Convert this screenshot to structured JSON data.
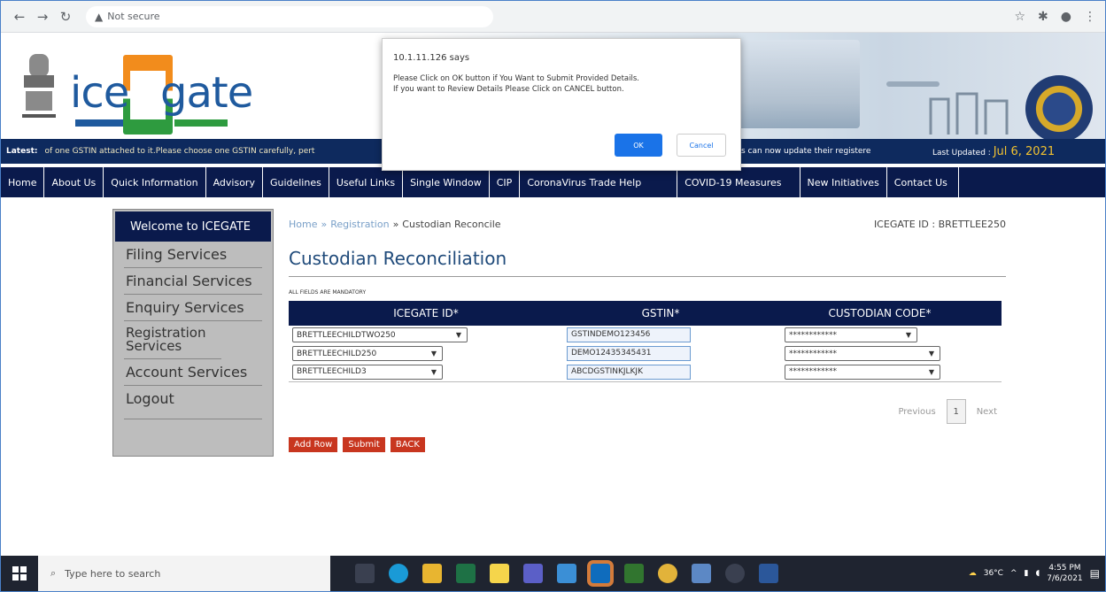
{
  "browser": {
    "security_label": "Not secure",
    "url": ""
  },
  "header": {
    "logo_left": "ice",
    "logo_right": "gate"
  },
  "ticker": {
    "label": "Latest:",
    "message": "of one GSTIN attached to it.Please choose one GSTIN carefully, pert",
    "message2": "s can now update their registere",
    "updated_label": "Last Updated :",
    "updated_date": "Jul 6, 2021"
  },
  "nav": [
    "Home",
    "About Us",
    "Quick Information",
    "Advisory",
    "Guidelines",
    "Useful Links",
    "Single Window",
    "CIP",
    "CoronaVirus Trade Help",
    "COVID-19 Measures",
    "New Initiatives",
    "Contact Us"
  ],
  "sidebar": {
    "welcome": "Welcome to ICEGATE",
    "items": [
      "Filing Services",
      "Financial Services",
      "Enquiry Services",
      "Registration Services",
      "Account Services",
      "Logout"
    ]
  },
  "breadcrumb": {
    "home": "Home",
    "sep": "»",
    "registration": "Registration",
    "current": "Custodian Reconcile",
    "user_id": "ICEGATE ID : BRETTLEE250"
  },
  "page": {
    "title": "Custodian Reconciliation",
    "mandatory": "ALL FIELDS ARE MANDATORY"
  },
  "table": {
    "headers": [
      "ICEGATE ID*",
      "GSTIN*",
      "CUSTODIAN CODE*"
    ],
    "rows": [
      {
        "icegate_id": "BRETTLEECHILDTWO250",
        "gstin": "GSTINDEMO123456",
        "custodian": "************"
      },
      {
        "icegate_id": "BRETTLEECHILD250",
        "gstin": "DEMO12435345431",
        "custodian": "************"
      },
      {
        "icegate_id": "BRETTLEECHILD3",
        "gstin": "ABCDGSTINKJLKJK",
        "custodian": "************"
      }
    ]
  },
  "pager": {
    "previous": "Previous",
    "page": "1",
    "next": "Next"
  },
  "buttons": {
    "add_row": "Add Row",
    "submit": "Submit",
    "back": "BACK"
  },
  "dialog": {
    "title": "10.1.11.126 says",
    "line1": "Please Click on OK button if You Want to Submit Provided Details.",
    "line2": "If you want to Review Details Please Click on CANCEL button.",
    "ok": "OK",
    "cancel": "Cancel"
  },
  "taskbar": {
    "search_placeholder": "Type here to search",
    "temperature": "36°C",
    "time": "4:55 PM",
    "date": "7/6/2021"
  }
}
